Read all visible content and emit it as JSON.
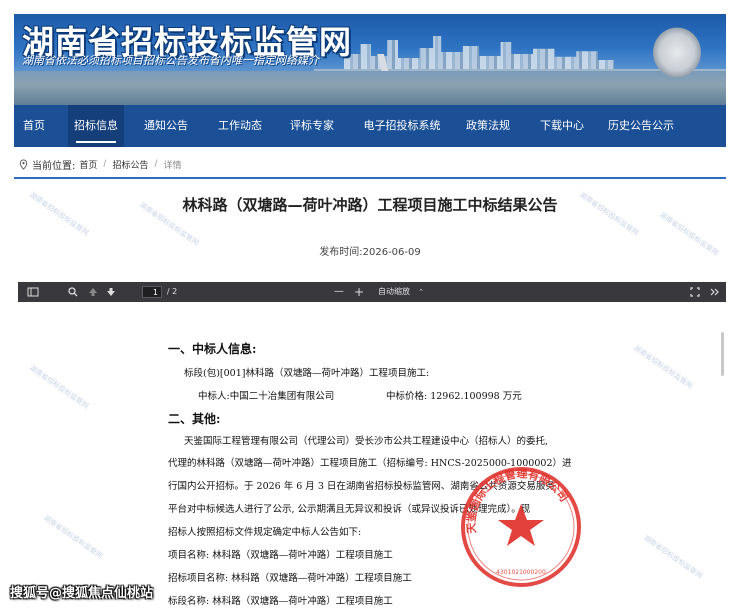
{
  "banner": {
    "title": "湖南省招标投标监管网",
    "subtitle": "湖南省依法必须招标项目招标公告发布省内唯一指定网络媒介"
  },
  "nav": [
    {
      "label": "首页",
      "active": false
    },
    {
      "label": "招标信息",
      "active": true
    },
    {
      "label": "通知公告",
      "active": false
    },
    {
      "label": "工作动态",
      "active": false
    },
    {
      "label": "评标专家",
      "active": false
    },
    {
      "label": "电子招投标系统",
      "active": false
    },
    {
      "label": "政策法规",
      "active": false
    },
    {
      "label": "下载中心",
      "active": false
    },
    {
      "label": "历史公告公示",
      "active": false
    }
  ],
  "breadcrumb": {
    "prefix": "当前位置:",
    "items": [
      "首页",
      "招标公告",
      "详情"
    ]
  },
  "article": {
    "title": "林科路（双塘路—荷叶冲路）工程项目施工中标结果公告",
    "date": "发布时间:2026-06-09"
  },
  "pdf_toolbar": {
    "page_current": "1",
    "page_total": "/ 2",
    "zoom_minus": "—",
    "zoom_plus": "+",
    "zoom_mode": "自动缩放",
    "zoom_caret": "⌃"
  },
  "document": {
    "section1_heading": "一、中标人信息:",
    "lot_line": "标段(包)[001]林科路（双塘路—荷叶冲路）工程项目施工:",
    "winner_label": "中标人:中国二十冶集团有限公司",
    "price_label": "中标价格: 12962.100998 万元",
    "section2_heading": "二、其他:",
    "para": [
      "天鉴国际工程管理有限公司（代理公司）受长沙市公共工程建设中心（招标人）的委托,",
      "代理的林科路（双塘路—荷叶冲路）工程项目施工（招标编号: HNCS-2025000-1000002）进",
      "行国内公开招标。于 2026 年 6 月 3 日在湖南省招标投标监管网、湖南省公共资源交易服务",
      "平台对中标候选人进行了公示, 公示期满且无异议和投诉（或异议投诉已处理完成）。现",
      "招标人按照招标文件规定确定中标人公告如下:",
      "项目名称: 林科路（双塘路—荷叶冲路）工程项目施工",
      "招标项目名称: 林科路（双塘路—荷叶冲路）工程项目施工",
      "标段名称: 林科路（双塘路—荷叶冲路）工程项目施工"
    ],
    "seal_text": "天鉴国际工程管理有限公司",
    "seal_number": "4301021000200"
  },
  "footer": {
    "source": "搜狐号@搜狐焦点仙桃站"
  },
  "watermark": "湖南省招标投标监管网",
  "colors": {
    "nav_bg": "#1b4f96",
    "accent_line": "#2e6cc0",
    "pdf_toolbar_bg": "#38383d",
    "seal_red": "#e0312b"
  }
}
